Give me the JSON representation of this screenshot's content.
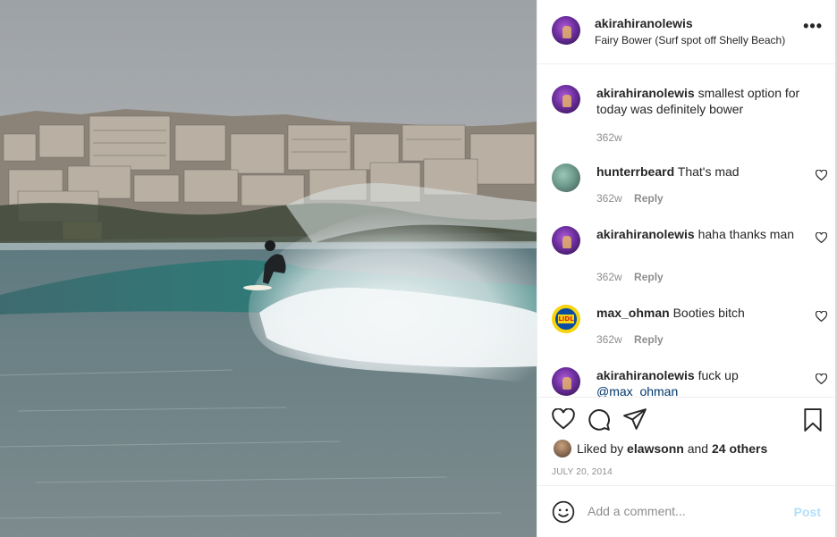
{
  "post": {
    "username": "akirahiranolewis",
    "location": "Fairy Bower (Surf spot off Shelly Beach)",
    "more_icon": "more-options-icon"
  },
  "comments": [
    {
      "user": "akirahiranolewis",
      "text": "smallest option for today was definitely bower",
      "mention": "",
      "time": "362w",
      "reply": "",
      "avatar": "purple"
    },
    {
      "user": "hunterrbeard",
      "text": "That's mad",
      "mention": "",
      "time": "362w",
      "reply": "Reply",
      "avatar": "photo"
    },
    {
      "user": "akirahiranolewis",
      "text": "haha thanks man",
      "mention": "",
      "time": "362w",
      "reply": "Reply",
      "avatar": "purple"
    },
    {
      "user": "max_ohman",
      "text": "Booties bitch",
      "mention": "",
      "time": "362w",
      "reply": "Reply",
      "avatar": "lidl"
    },
    {
      "user": "akirahiranolewis",
      "text": "fuck up",
      "mention": "@max_ohman",
      "time": "",
      "reply": "",
      "avatar": "purple"
    }
  ],
  "likes": {
    "prefix": "Liked by",
    "user": "elawsonn",
    "joiner": "and",
    "others": "24 others"
  },
  "date": "JULY 20, 2014",
  "comment_box": {
    "placeholder": "Add a comment...",
    "post_label": "Post"
  },
  "lidl_label": "LIDL",
  "colors": {
    "link": "#00376b",
    "post_disabled": "#b2dffc",
    "muted": "#8e8e8e"
  },
  "icons": [
    "heart-icon",
    "comment-icon",
    "share-icon",
    "bookmark-icon",
    "emoji-icon"
  ]
}
